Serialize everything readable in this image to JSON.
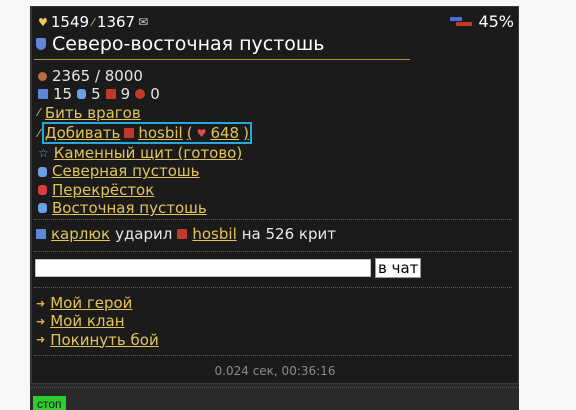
{
  "status": {
    "health": "1549",
    "energy": "1367",
    "battery_percent": "45%"
  },
  "location": {
    "name": "Северо-восточная пустошь"
  },
  "stats": {
    "progress": "2365 / 8000",
    "blue_count": "15",
    "shield_count": "5",
    "red_count": "9",
    "cross_count": "0"
  },
  "actions": {
    "fight_enemies": "Бить врагов",
    "finish_label": "Добивать",
    "finish_target": "hosbil",
    "finish_open": "(",
    "finish_hp": "648",
    "finish_close": ")",
    "stone_shield": "Каменный щит (готово)",
    "north": "Северная пустошь",
    "crossroads": "Перекрёсток",
    "east": "Восточная пустошь"
  },
  "log": {
    "attacker": "карлюк",
    "verb": "ударил",
    "target": "hosbil",
    "rest": "на 526 крит"
  },
  "chat": {
    "button_label": "в чат",
    "input_value": ""
  },
  "menu": {
    "hero": "Мой герой",
    "clan": "Мой клан",
    "leave": "Покинуть бой"
  },
  "footer": {
    "timing": "0.024 сек, 00:36:16"
  },
  "stop": {
    "label": "стоп"
  },
  "colors": {
    "link": "#e3c45a",
    "highlight": "#26a8d8",
    "stop": "#2ecc2e"
  }
}
